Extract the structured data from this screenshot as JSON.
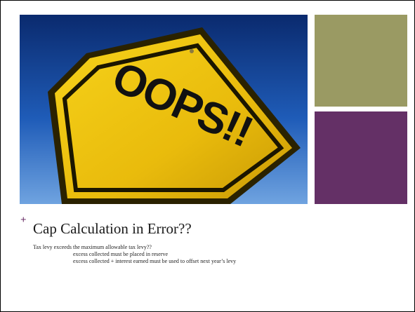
{
  "colors": {
    "accent_plus": "#6b3068",
    "olive_block": "#9a9a63",
    "purple_block": "#643066",
    "title_text": "#1a1a1a"
  },
  "slide": {
    "image": {
      "icon": "oops-road-sign-image",
      "sign_text": "OOPS!!"
    },
    "plus_symbol": "+",
    "title": "Cap Calculation in Error??",
    "body": {
      "line1": "Tax levy exceeds the maximum allowable tax levy??",
      "line2": "excess collected must be placed in reserve",
      "line3": "excess collected + interest earned must be used to offset next year’s levy"
    }
  }
}
